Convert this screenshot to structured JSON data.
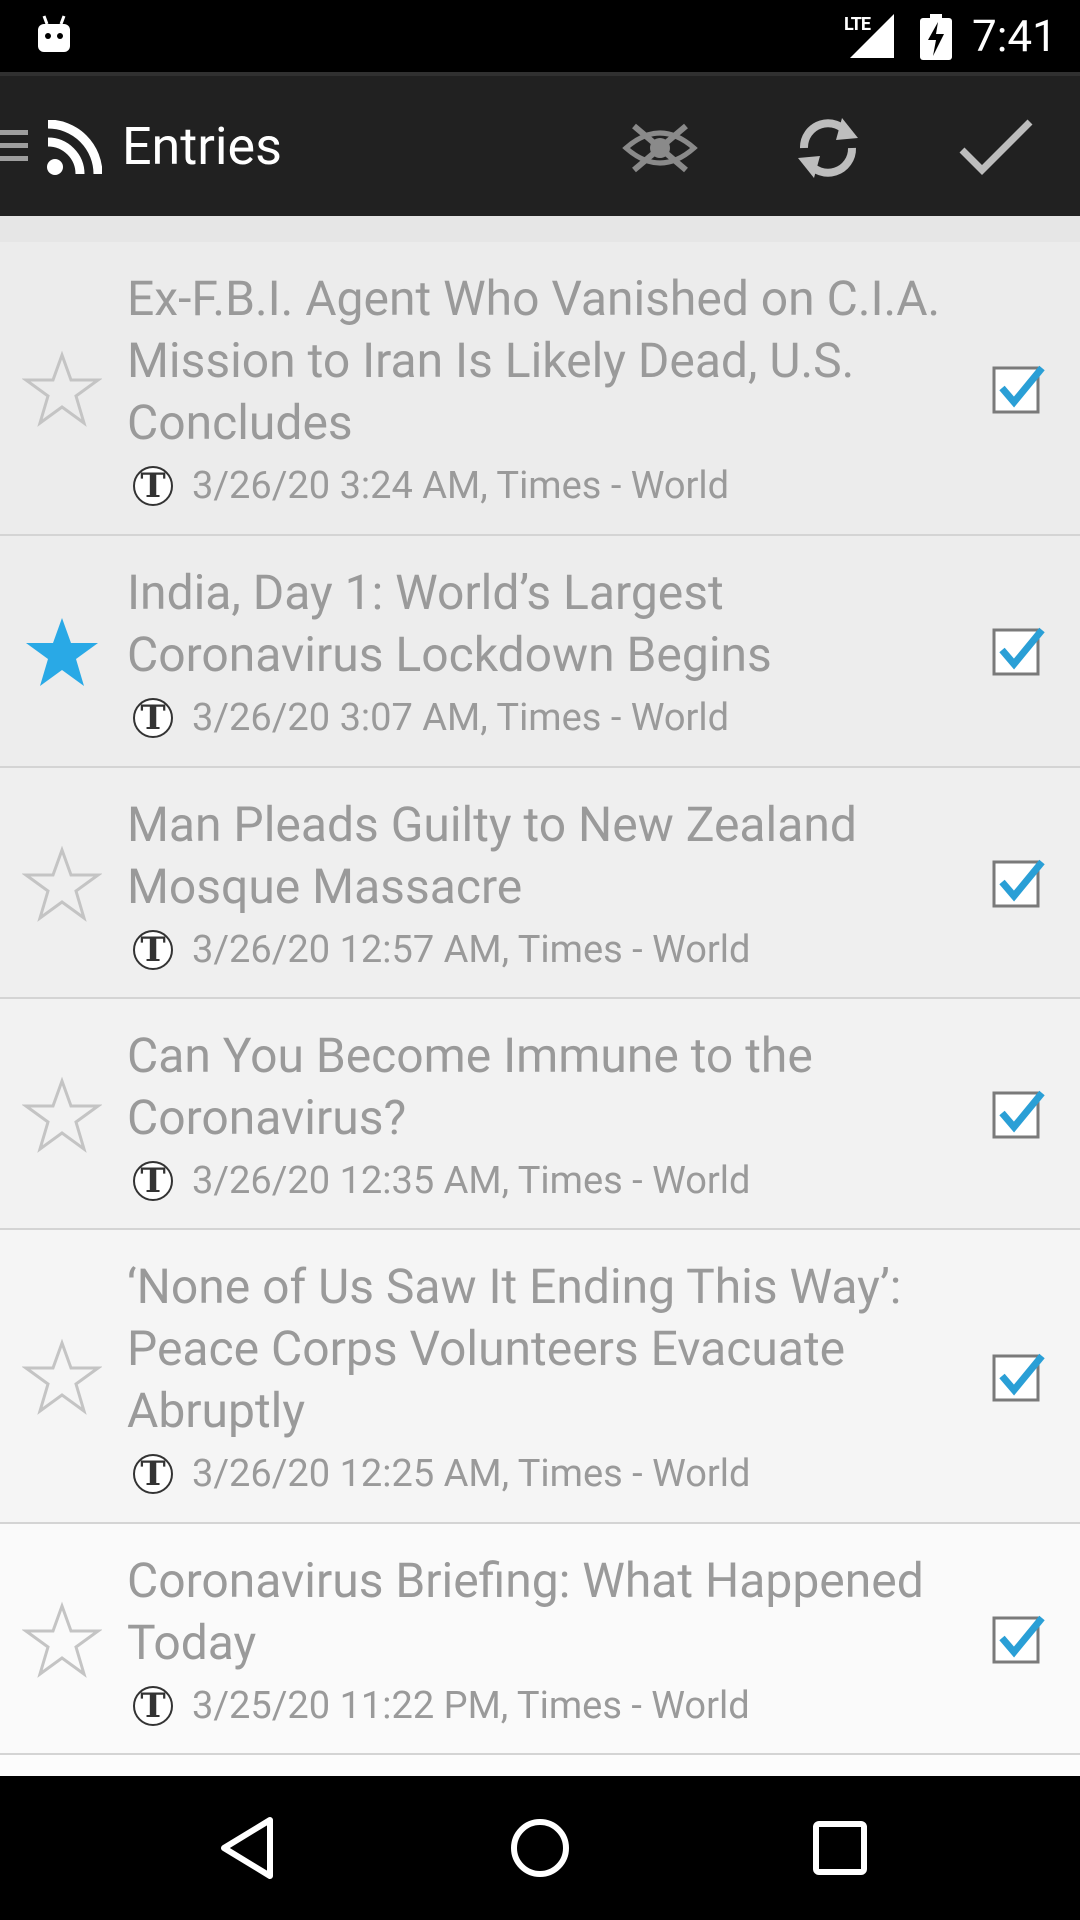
{
  "status_bar": {
    "network": "LTE",
    "time": "7:41"
  },
  "toolbar": {
    "title": "Entries",
    "icons": [
      "menu-icon",
      "rss-icon",
      "hide-read-icon",
      "refresh-icon",
      "mark-all-read-icon"
    ]
  },
  "entries": [
    {
      "title": "Ex-F.B.I. Agent Who Vanished on C.I.A. Mission to Iran Is Likely Dead, U.S. Concludes",
      "meta": "3/26/20 3:24 AM, Times - World",
      "starred": false,
      "read": true
    },
    {
      "title": "India, Day 1: World’s Largest Coronavirus Lockdown Begins",
      "meta": "3/26/20 3:07 AM, Times - World",
      "starred": true,
      "read": true
    },
    {
      "title": "Man Pleads Guilty to New Zealand Mosque Massacre",
      "meta": "3/26/20 12:57 AM, Times - World",
      "starred": false,
      "read": true
    },
    {
      "title": "Can You Become Immune to the Coronavirus?",
      "meta": "3/26/20 12:35 AM, Times - World",
      "starred": false,
      "read": true
    },
    {
      "title": "‘None of Us Saw It Ending This Way’: Peace Corps Volunteers Evacuate Abruptly",
      "meta": "3/26/20 12:25 AM, Times - World",
      "starred": false,
      "read": true
    },
    {
      "title": "Coronavirus Briefing: What Happened Today",
      "meta": "3/25/20 11:22 PM, Times - World",
      "starred": false,
      "read": true
    }
  ],
  "colors": {
    "star_active": "#29a9e6",
    "check": "#2a9fd6",
    "text_read": "#9a9a9a",
    "toolbar": "#212121"
  }
}
